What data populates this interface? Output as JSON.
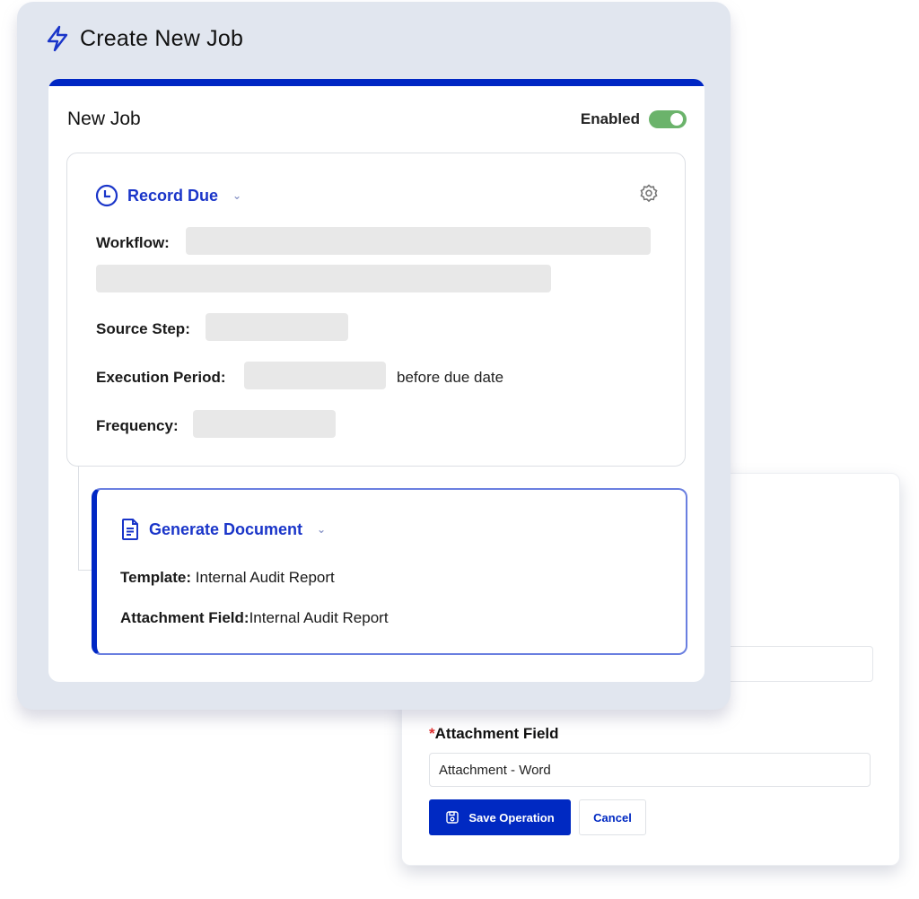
{
  "dialog": {
    "title": "Create New Job",
    "title_icon": "lightning-icon",
    "accent_color": "#0027c4"
  },
  "job": {
    "name": "New Job",
    "enabled_label": "Enabled",
    "enabled": true,
    "toggle_color": "#6bb36b"
  },
  "trigger": {
    "type_label": "Record Due",
    "icon": "clock-icon",
    "settings_icon": "gear-icon",
    "fields": {
      "workflow_label": "Workflow:",
      "source_step_label": "Source Step:",
      "execution_period_label": "Execution Period:",
      "execution_period_suffix": "before due date",
      "frequency_label": "Frequency:"
    }
  },
  "action": {
    "type_label": "Generate Document",
    "icon": "document-icon",
    "template_label": "Template:",
    "template_value": "Internal Audit Report",
    "attachment_label": "Attachment Field:",
    "attachment_value": "Internal Audit Report"
  },
  "operation_panel": {
    "attachment_field_label": "Attachment Field",
    "required_marker": "*",
    "attachment_field_value": "Attachment - Word",
    "save_button": "Save Operation",
    "save_icon": "save-icon",
    "cancel_button": "Cancel"
  }
}
